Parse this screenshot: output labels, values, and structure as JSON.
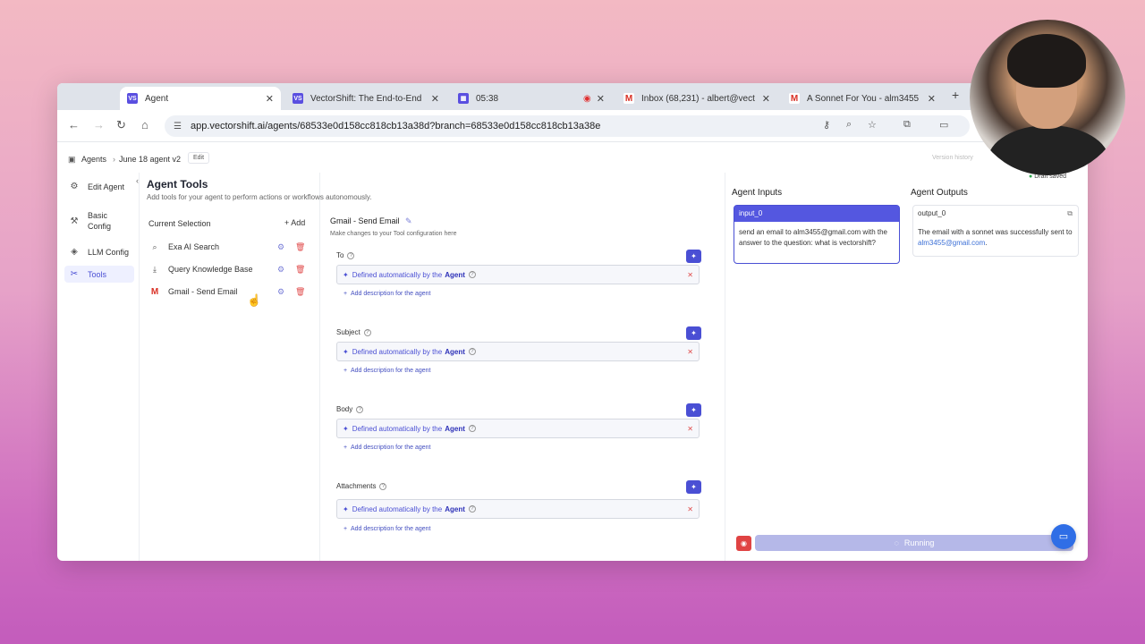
{
  "browser": {
    "tabs": [
      {
        "label": "Agent",
        "favicon": "VS",
        "favicon_color": "#5a4fe0",
        "active": true
      },
      {
        "label": "VectorShift: The End-to-End ",
        "favicon": "VS",
        "favicon_color": "#5a4fe0",
        "active": false
      },
      {
        "label": "05:38",
        "favicon": "rec",
        "favicon_color": "#5a4fe0",
        "active": false
      },
      {
        "label": "Inbox (68,231) - albert@vect",
        "favicon": "M",
        "favicon_color": "#d93025",
        "active": false
      },
      {
        "label": "A Sonnet For You - alm3455",
        "favicon": "M",
        "favicon_color": "#d93025",
        "active": false
      }
    ],
    "new_tab": "+",
    "url": "app.vectorshift.ai/agents/68533e0d158cc818cb13a38d?branch=68533e0d158cc818cb13a38e"
  },
  "header": {
    "breadcrumb_root": "Agents",
    "breadcrumb_current": "June 18 agent v2",
    "edit_label": "Edit",
    "version_history": "Version history",
    "draft_status": "Draft saved"
  },
  "sidebar": {
    "items": [
      {
        "label": "Edit Agent",
        "icon": "gear-icon"
      },
      {
        "label": "Basic Config",
        "icon": "sliders-icon"
      },
      {
        "label": "LLM Config",
        "icon": "layers-icon"
      },
      {
        "label": "Tools",
        "icon": "tools-icon"
      }
    ]
  },
  "tools": {
    "title": "Agent Tools",
    "subtitle": "Add tools for your agent to perform actions or workflows autonomously.",
    "current_selection": "Current Selection",
    "add_label": "Add",
    "items": [
      {
        "label": "Exa AI Search",
        "icon": "search-icon"
      },
      {
        "label": "Query Knowledge Base",
        "icon": "download-icon"
      },
      {
        "label": "Gmail - Send Email",
        "icon": "gmail-icon"
      }
    ]
  },
  "config": {
    "tool_name": "Gmail - Send Email",
    "hint": "Make changes to your Tool configuration here",
    "fields": [
      {
        "label": "To",
        "value_prefix": "Defined automatically by the",
        "value_bold": "Agent",
        "add_desc": "Add description for the agent"
      },
      {
        "label": "Subject",
        "value_prefix": "Defined automatically by the",
        "value_bold": "Agent",
        "add_desc": "Add description for the agent"
      },
      {
        "label": "Body",
        "value_prefix": "Defined automatically by the",
        "value_bold": "Agent",
        "add_desc": "Add description for the agent"
      },
      {
        "label": "Attachments",
        "value_prefix": "Defined automatically by the",
        "value_bold": "Agent",
        "add_desc": "Add description for the agent"
      }
    ]
  },
  "io": {
    "inputs_title": "Agent Inputs",
    "input_name": "input_0",
    "input_text": "send an email to alm3455@gmail.com with the answer to the question: what is vectorshift?",
    "outputs_title": "Agent Outputs",
    "output_name": "output_0",
    "output_text": "The email with a sonnet was successfully sent to",
    "output_link": "alm3455@gmail.com",
    "output_end": "."
  },
  "status": {
    "running_label": "Running"
  },
  "colors": {
    "accent": "#4a4fd4",
    "delete": "#e04b4b",
    "running_bar": "#b5b8e8"
  }
}
